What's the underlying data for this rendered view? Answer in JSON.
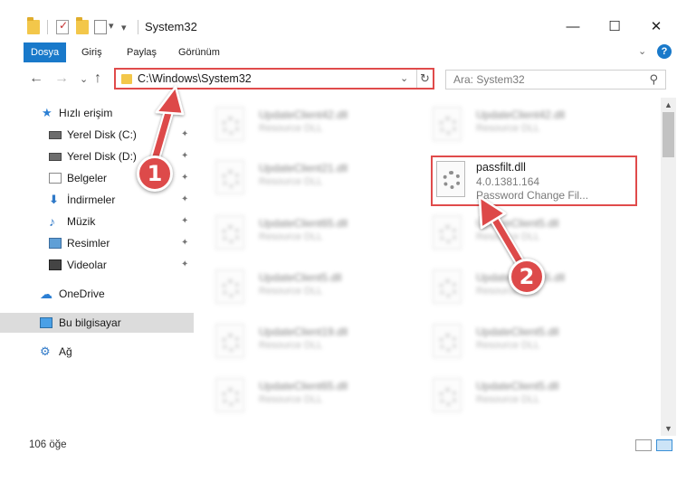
{
  "window": {
    "title": "System32",
    "minimize_glyph": "—",
    "maximize_glyph": "☐",
    "close_glyph": "✕",
    "qa_dropdown_glyph": "▾"
  },
  "ribbon": {
    "tabs": [
      {
        "label": "Dosya",
        "active": true
      },
      {
        "label": "Giriş",
        "active": false
      },
      {
        "label": "Paylaş",
        "active": false
      },
      {
        "label": "Görünüm",
        "active": false
      }
    ],
    "collapse_glyph": "⌄",
    "help_glyph": "?"
  },
  "nav": {
    "back_glyph": "←",
    "forward_glyph": "→",
    "recent_glyph": "⌄",
    "up_glyph": "↑",
    "address_path": "C:\\Windows\\System32",
    "address_chevron": "⌄",
    "refresh_glyph": "↻",
    "search_placeholder": "Ara: System32",
    "search_glyph": "⚲"
  },
  "sidebar": {
    "pin_glyph": "✦",
    "items": [
      {
        "label": "Hızlı erişim",
        "icon": "star-icon",
        "glyph": "★",
        "pinned": false
      },
      {
        "label": "Yerel Disk (C:)",
        "icon": "drive-icon",
        "pinned": true
      },
      {
        "label": "Yerel Disk (D:)",
        "icon": "drive-icon",
        "pinned": true
      },
      {
        "label": "Belgeler",
        "icon": "documents-icon",
        "pinned": true
      },
      {
        "label": "İndirmeler",
        "icon": "download-icon",
        "glyph": "⬇",
        "pinned": true
      },
      {
        "label": "Müzik",
        "icon": "music-icon",
        "glyph": "♪",
        "pinned": true
      },
      {
        "label": "Resimler",
        "icon": "pictures-icon",
        "pinned": true
      },
      {
        "label": "Videolar",
        "icon": "video-icon",
        "pinned": true
      },
      {
        "label": "OneDrive",
        "icon": "cloud-icon",
        "glyph": "☁",
        "pinned": false
      },
      {
        "label": "Bu bilgisayar",
        "icon": "computer-icon",
        "pinned": false,
        "selected": true
      },
      {
        "label": "Ağ",
        "icon": "network-icon",
        "glyph": "⚙",
        "pinned": false
      }
    ]
  },
  "files": {
    "background": [
      {
        "name": "UpdateClient42.dll",
        "desc": "Resource DLL"
      },
      {
        "name": "UpdateClient42.dll",
        "desc": "Resource DLL"
      },
      {
        "name": "UpdateClient21.dll",
        "desc": "Resource DLL"
      },
      {
        "name": "UpdateClient65.dll",
        "desc": "Resource DLL"
      },
      {
        "name": "UpdateClient5.dll",
        "desc": "Resource DLL"
      },
      {
        "name": "UpdateClient5.dll",
        "desc": "Resource DLL"
      },
      {
        "name": "UpdateClient65.dll",
        "desc": "Resource DLL"
      },
      {
        "name": "UpdateClient19.dll",
        "desc": "Resource DLL"
      },
      {
        "name": "UpdateClient5.dll",
        "desc": "Resource DLL"
      },
      {
        "name": "UpdateClient65.dll",
        "desc": "Resource DLL"
      },
      {
        "name": "UpdateClient5.dll",
        "desc": "Resource DLL"
      }
    ],
    "highlighted": {
      "name": "passfilt.dll",
      "version": "4.0.1381.164",
      "description": "Password Change Fil..."
    }
  },
  "scrollbar": {
    "up_glyph": "▲",
    "down_glyph": "▼"
  },
  "status": {
    "item_count": "106 öğe"
  },
  "annotations": {
    "badge1": "1",
    "badge2": "2",
    "accent": "#dd4a4a"
  }
}
